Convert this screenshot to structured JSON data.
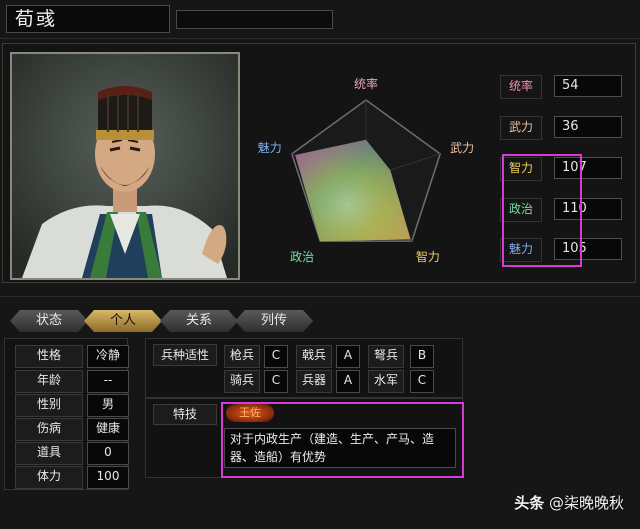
{
  "officer": {
    "name": "荀彧"
  },
  "radar": {
    "axes": [
      "统率",
      "武力",
      "智力",
      "政治",
      "魅力"
    ],
    "values": [
      54,
      36,
      107,
      110,
      105
    ],
    "max": 110,
    "colors": {
      "统率": "#f0a0c0",
      "武力": "#f0c0a0",
      "智力": "#f0d060",
      "政治": "#70e0a0",
      "魅力": "#80b0f0"
    }
  },
  "stats": [
    {
      "label": "统率",
      "value": "54",
      "color": "#f090b0"
    },
    {
      "label": "武力",
      "value": "36",
      "color": "#f0c0a0"
    },
    {
      "label": "智力",
      "value": "107",
      "color": "#f0d060"
    },
    {
      "label": "政治",
      "value": "110",
      "color": "#70e0a0"
    },
    {
      "label": "魅力",
      "value": "105",
      "color": "#80b0f0"
    }
  ],
  "tabs": [
    {
      "label": "状态",
      "active": false
    },
    {
      "label": "个人",
      "active": true
    },
    {
      "label": "关系",
      "active": false
    },
    {
      "label": "列传",
      "active": false
    }
  ],
  "personal": [
    {
      "label": "性格",
      "value": "冷静"
    },
    {
      "label": "年龄",
      "value": "--"
    },
    {
      "label": "性别",
      "value": "男"
    },
    {
      "label": "伤病",
      "value": "健康"
    },
    {
      "label": "道具",
      "value": "0"
    },
    {
      "label": "体力",
      "value": "100"
    }
  ],
  "troops": {
    "header": "兵种适性",
    "items": [
      {
        "name": "枪兵",
        "rank": "C"
      },
      {
        "name": "戟兵",
        "rank": "A"
      },
      {
        "name": "弩兵",
        "rank": "B"
      },
      {
        "name": "骑兵",
        "rank": "C"
      },
      {
        "name": "兵器",
        "rank": "A"
      },
      {
        "name": "水军",
        "rank": "C"
      }
    ]
  },
  "skill": {
    "header": "特技",
    "name": "王佐",
    "description": "对于内政生产（建造、生产、产马、造器、造船）有优势"
  },
  "watermark": {
    "prefix": "头条",
    "handle": "@柒晚晚秋"
  }
}
